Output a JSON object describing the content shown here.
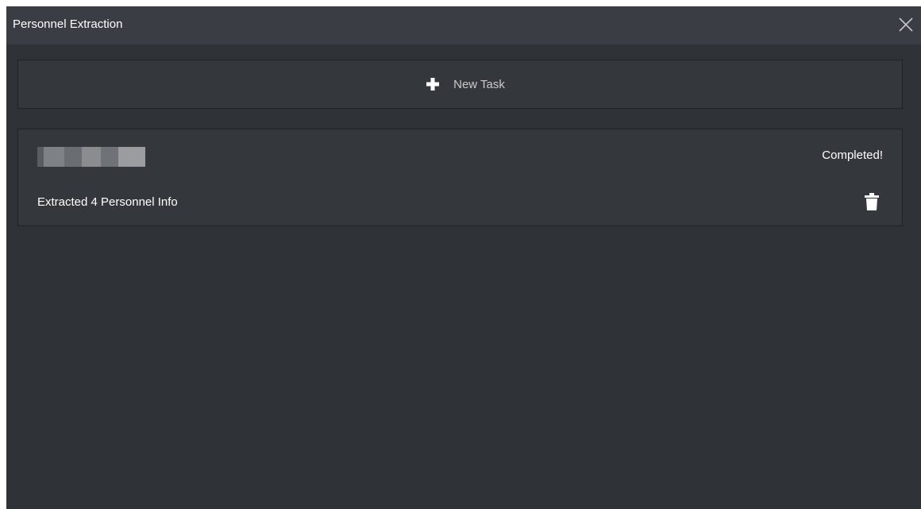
{
  "dialog": {
    "title": "Personnel Extraction",
    "close_icon": "close-icon"
  },
  "new_task": {
    "label": "New Task",
    "icon": "plus-icon"
  },
  "tasks": [
    {
      "status": "Completed!",
      "summary": "Extracted 4 Personnel Info",
      "delete_icon": "trash-icon"
    }
  ],
  "colors": {
    "background": "#2f3237",
    "titlebar": "#3a3d43",
    "card": "#34373c",
    "border": "#1f2125",
    "text": "#ffffff"
  }
}
